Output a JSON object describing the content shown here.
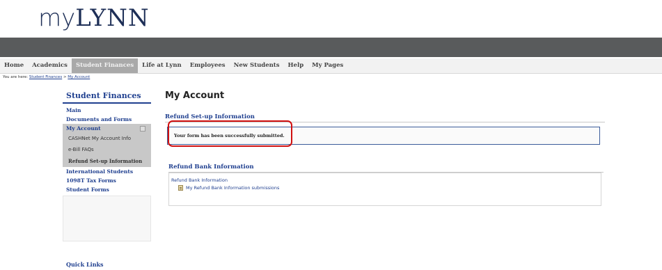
{
  "header": {
    "logo_prefix": "my",
    "logo_brand": "LYNN"
  },
  "nav": {
    "items": [
      {
        "label": "Home"
      },
      {
        "label": "Academics"
      },
      {
        "label": "Student Finances"
      },
      {
        "label": "Life at Lynn"
      },
      {
        "label": "Employees"
      },
      {
        "label": "New Students"
      },
      {
        "label": "Help"
      },
      {
        "label": "My Pages"
      }
    ],
    "active_index": 2
  },
  "breadcrumb": {
    "prefix": "You are here:",
    "link1": "Student Finances",
    "separator": ">",
    "link2": "My Account"
  },
  "sidebar": {
    "title": "Student Finances",
    "main": "Main",
    "documents": "Documents and Forms",
    "my_account": "My Account",
    "sub": {
      "cashnet": "CASHNet My Account Info",
      "ebill": "e-Bill FAQs",
      "refund": "Refund Set-up Information"
    },
    "international": "International Students",
    "tax": "1098T Tax Forms",
    "student_forms": "Student Forms",
    "quick_links": "Quick Links"
  },
  "main": {
    "title": "My Account",
    "section1_title": "Refund Set-up Information",
    "alert_text": "Your form has been successfully submitted.",
    "section2_title": "Refund Bank Information",
    "panel_label": "Refund Bank Information",
    "panel_link": "My Refund Bank Information submissions"
  },
  "colors": {
    "banner": "#595b5c",
    "brand_blue": "#1f3f8f",
    "highlight_red": "#d01010",
    "active_nav": "#a9a9a9"
  }
}
